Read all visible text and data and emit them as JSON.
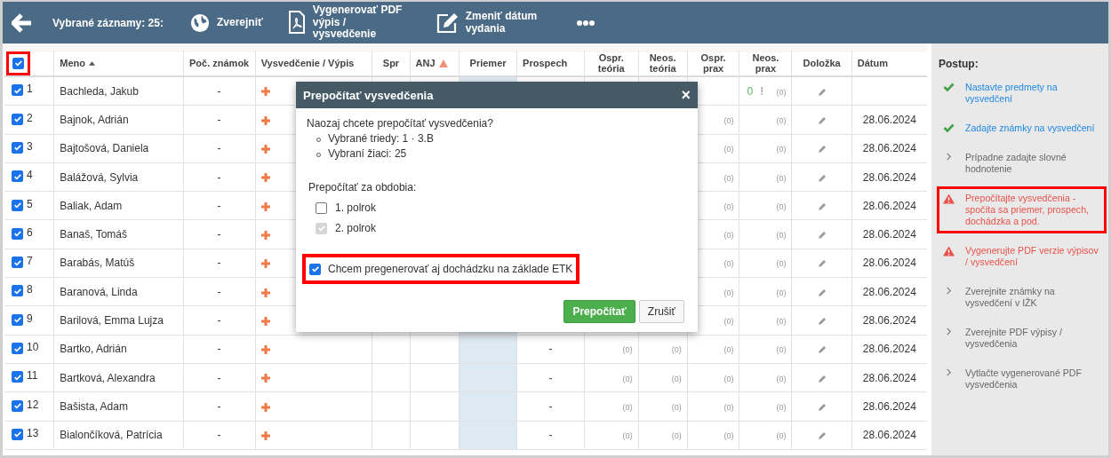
{
  "toolbar": {
    "selected_label": "Vybrané záznamy: 25:",
    "actions": [
      {
        "kind": "publish",
        "label": "Zverejniť"
      },
      {
        "kind": "pdf",
        "label": "Vygenerovať PDF výpis / vysvedčenie"
      },
      {
        "kind": "edit",
        "label": "Zmeniť dátum vydania"
      },
      {
        "kind": "more"
      }
    ]
  },
  "table": {
    "select_all": {
      "checked": true,
      "highlighted": true
    },
    "columns": [
      {
        "label": "Meno",
        "sorted": true
      },
      {
        "label": "Poč. známok"
      },
      {
        "label": "Vysvedčenie / Výpis"
      },
      {
        "label": "Spr"
      },
      {
        "label": "ANJ",
        "warning": true
      },
      {
        "label": "Priemer"
      },
      {
        "label": "Prospech"
      },
      {
        "label": "Ospr. teória"
      },
      {
        "label": "Neos. teória"
      },
      {
        "label": "Ospr. prax"
      },
      {
        "label": "Neos. prax"
      },
      {
        "label": "Doložka"
      },
      {
        "label": "Dátum"
      }
    ],
    "rows": [
      {
        "checked": true,
        "number": "1",
        "name": "Bachleda, Jakub",
        "count": "-",
        "neos_prax_value": "0",
        "neos_prax_mark": "!",
        "neos_prax": "(0)"
      },
      {
        "checked": true,
        "number": "2",
        "name": "Bajnok, Adrián",
        "count": "-",
        "ospr_prax": "(0)",
        "neos_prax": "(0)",
        "date": "28.06.2024"
      },
      {
        "checked": true,
        "number": "3",
        "name": "Bajtošová, Daniela",
        "count": "-",
        "ospr_prax": "(0)",
        "neos_prax": "(0)",
        "date": "28.06.2024"
      },
      {
        "checked": true,
        "number": "4",
        "name": "Balážová, Sylvia",
        "count": "-",
        "ospr_prax": "(0)",
        "neos_prax": "(0)",
        "date": "28.06.2024"
      },
      {
        "checked": true,
        "number": "5",
        "name": "Baliak, Adam",
        "count": "-",
        "ospr_prax": "(0)",
        "neos_prax": "(0)",
        "date": "28.06.2024"
      },
      {
        "checked": true,
        "number": "6",
        "name": "Banaš, Tomáš",
        "count": "-",
        "ospr_prax": "(0)",
        "neos_prax": "(0)",
        "date": "28.06.2024"
      },
      {
        "checked": true,
        "number": "7",
        "name": "Barabás, Matúš",
        "count": "-",
        "ospr_prax": "(0)",
        "neos_prax": "(0)",
        "date": "28.06.2024"
      },
      {
        "checked": true,
        "number": "8",
        "name": "Baranová, Linda",
        "count": "-",
        "ospr_prax": "(0)",
        "neos_prax": "(0)",
        "date": "28.06.2024"
      },
      {
        "checked": true,
        "number": "9",
        "name": "Barilová, Emma Lujza",
        "count": "-",
        "ospr_prax": "(0)",
        "neos_prax": "(0)",
        "date": "28.06.2024"
      },
      {
        "checked": true,
        "number": "10",
        "name": "Bartko, Adrián",
        "count": "-",
        "prospech": "-",
        "ospr_teoria": "(0)",
        "neos_teoria": "(0)",
        "ospr_prax": "(0)",
        "neos_prax": "(0)",
        "date": "28.06.2024"
      },
      {
        "checked": true,
        "number": "11",
        "name": "Bartková, Alexandra",
        "count": "-",
        "prospech": "-",
        "ospr_teoria": "(0)",
        "neos_teoria": "(0)",
        "ospr_prax": "(0)",
        "neos_prax": "(0)",
        "date": "28.06.2024"
      },
      {
        "checked": true,
        "number": "12",
        "name": "Bašista, Adam",
        "count": "-",
        "prospech": "-",
        "ospr_teoria": "(0)",
        "neos_teoria": "(0)",
        "ospr_prax": "(0)",
        "neos_prax": "(0)",
        "date": "28.06.2024"
      },
      {
        "checked": true,
        "number": "13",
        "name": "Bialončíková, Patrícia",
        "count": "-",
        "prospech": "-",
        "ospr_teoria": "(0)",
        "neos_teoria": "(0)",
        "ospr_prax": "(0)",
        "neos_prax": "(0)",
        "date": "28.06.2024"
      }
    ]
  },
  "dialog": {
    "title": "Prepočítať vysvedčenia",
    "close": "×",
    "question": "Naozaj chcete prepočítať vysvedčenia?",
    "details": [
      "Vybrané triedy: 1 · 3.B",
      "Vybraní žiaci: 25"
    ],
    "periods_label": "Prepočítať za obdobia:",
    "periods": [
      {
        "label": "1. polrok",
        "checked": false,
        "disabled": false
      },
      {
        "label": "2. polrok",
        "checked": true,
        "disabled": true
      }
    ],
    "option": {
      "label": "Chcem pregenerovať aj dochádzku na základe ETK",
      "checked": true,
      "highlighted": true
    },
    "buttons": [
      {
        "kind": "primary",
        "label": "Prepočítať"
      },
      {
        "kind": "secondary",
        "label": "Zrušiť"
      }
    ]
  },
  "sidebar": {
    "title": "Postup:",
    "steps": [
      {
        "kind": "done",
        "label": "Nastavte predmety na vysvedčení",
        "highlighted": false
      },
      {
        "kind": "done",
        "label": "Zadajte známky na vysvedčení",
        "highlighted": false
      },
      {
        "kind": "todo",
        "label": "Prípadne zadajte slovné hodnotenie",
        "highlighted": false
      },
      {
        "kind": "warning",
        "label": "Prepočítajte vysvedčenia - spočíta sa priemer, prospech, dochádzka a pod.",
        "highlighted": true
      },
      {
        "kind": "warning",
        "label": "Vygenerujte PDF verzie výpisov / vysvedčení",
        "highlighted": false
      },
      {
        "kind": "todo",
        "label": "Zverejnite známky na vysvedčení v IŽK",
        "highlighted": false
      },
      {
        "kind": "todo",
        "label": "Zverejnite PDF výpisy / vysvedčenia",
        "highlighted": false
      },
      {
        "kind": "todo",
        "label": "Vytlačte vygenerované PDF vysvedčenia",
        "highlighted": false
      }
    ]
  }
}
